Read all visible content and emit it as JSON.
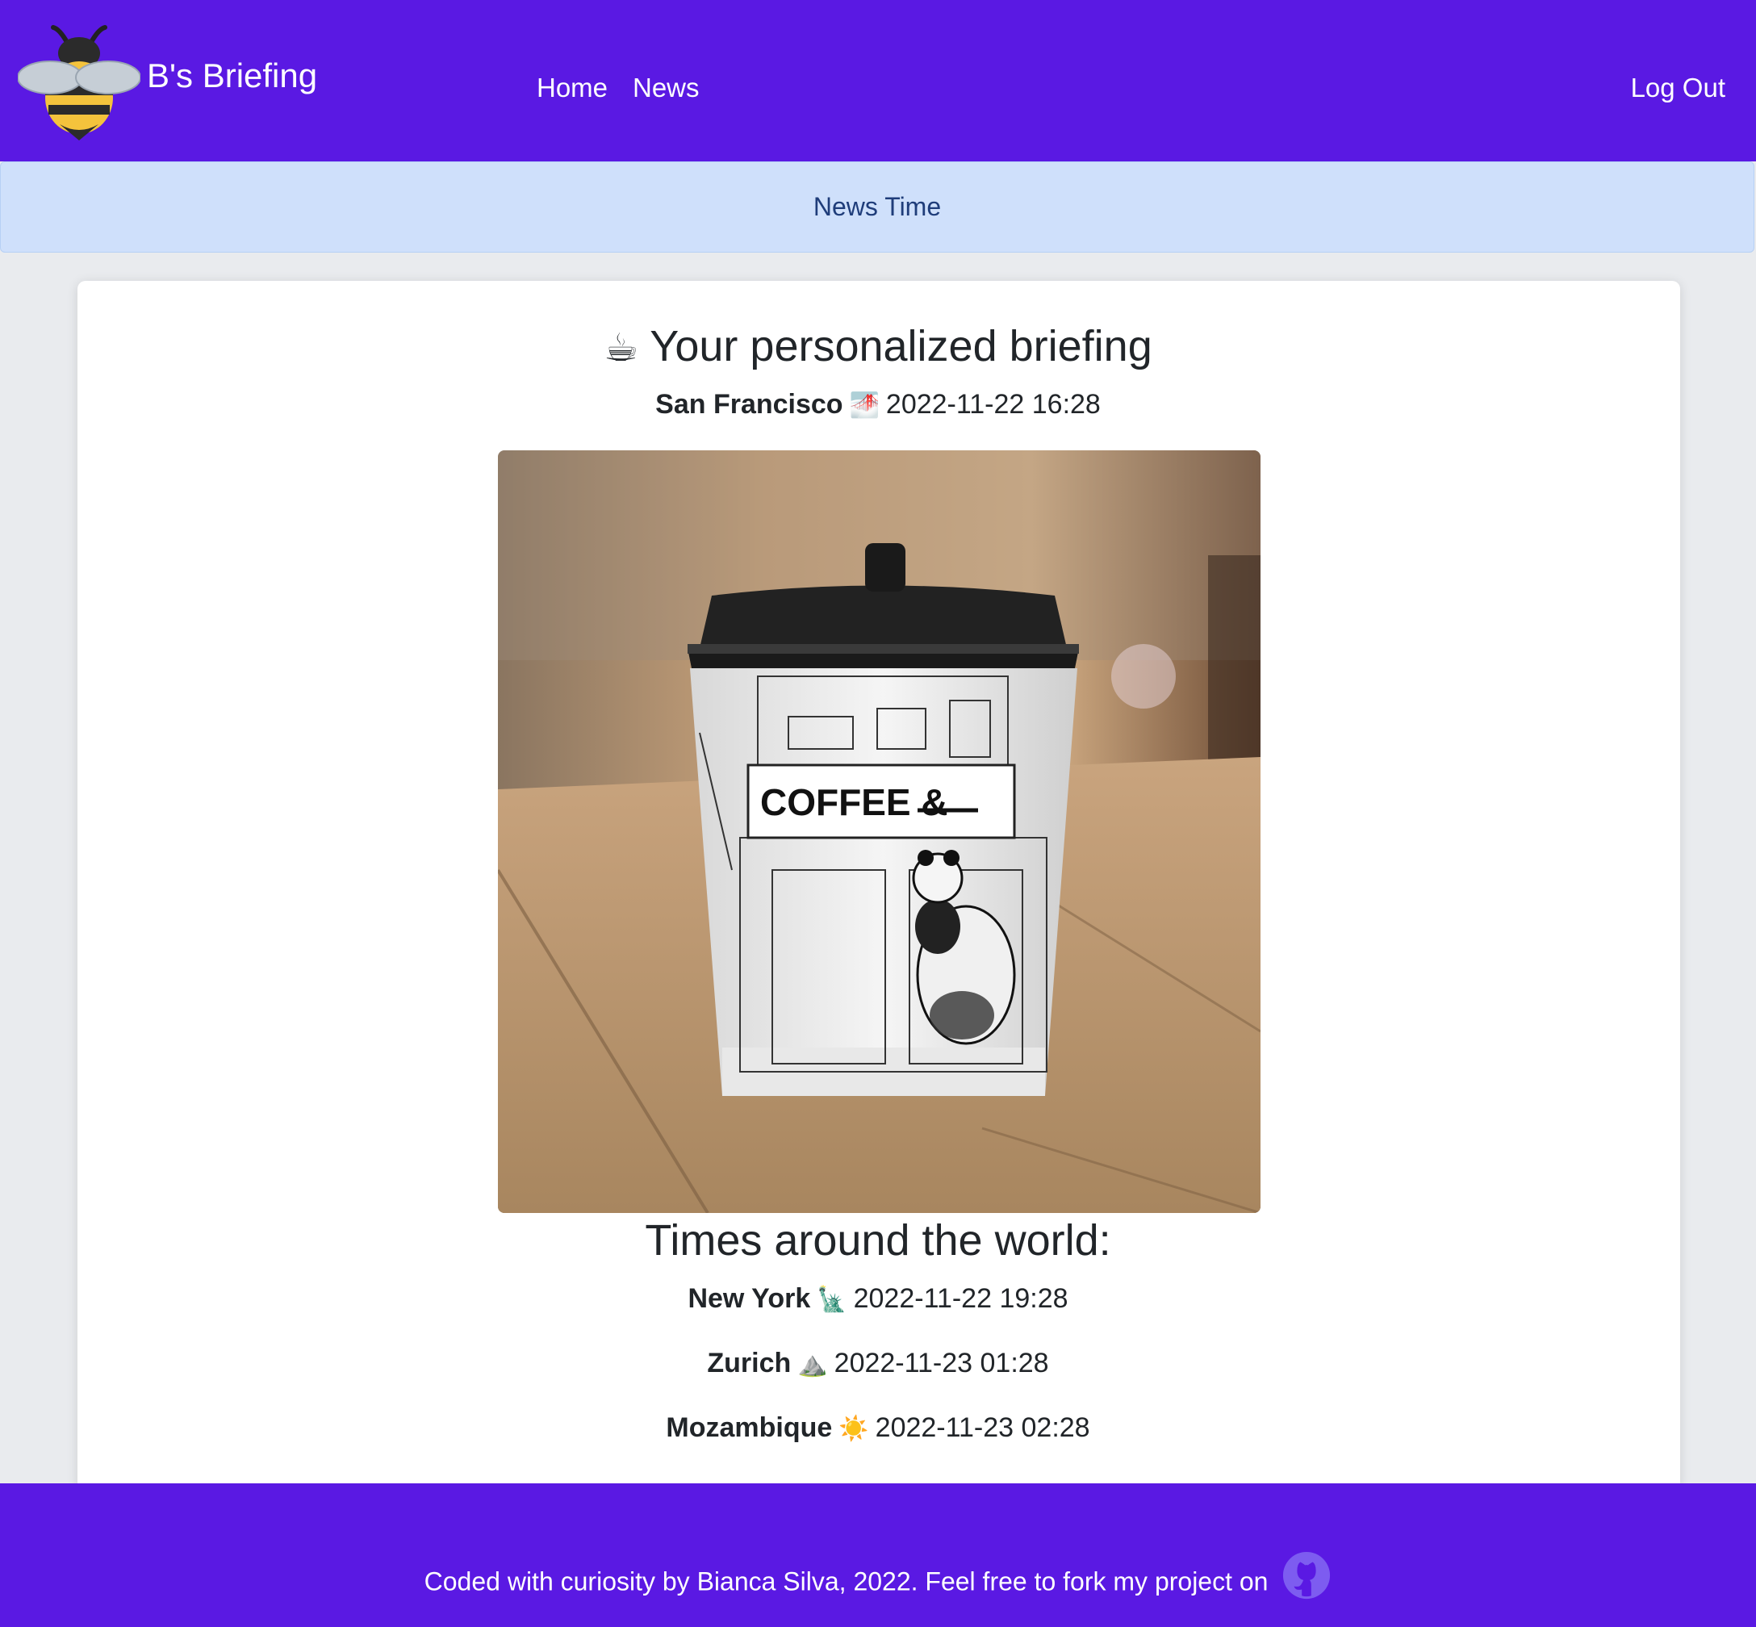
{
  "navbar": {
    "brand": "B's Briefing",
    "links": [
      "Home",
      "News"
    ],
    "logout": "Log Out",
    "logo_icon": "bee-icon",
    "bg_color": "#5a19e3"
  },
  "alert": {
    "text": "News Time",
    "bg_color": "#cfe0fb"
  },
  "briefing": {
    "cup_emoji": "☕",
    "title": "Your personalized briefing",
    "local": {
      "city": "San Francisco",
      "emoji": "🌁",
      "time": "2022-11-22 16:28"
    },
    "image_icon": "coffee-cup-photo",
    "image_text": "COFFEE &"
  },
  "world": {
    "title": "Times around the world:",
    "cities": [
      {
        "city": "New York",
        "emoji": "🗽",
        "time": "2022-11-22 19:28"
      },
      {
        "city": "Zurich",
        "emoji": "⛰️",
        "time": "2022-11-23 01:28"
      },
      {
        "city": "Mozambique",
        "emoji": "☀️",
        "time": "2022-11-23 02:28"
      }
    ]
  },
  "footer": {
    "text": "Coded with curiosity by Bianca Silva, 2022. Feel free to fork my project on",
    "icon": "github-icon"
  }
}
